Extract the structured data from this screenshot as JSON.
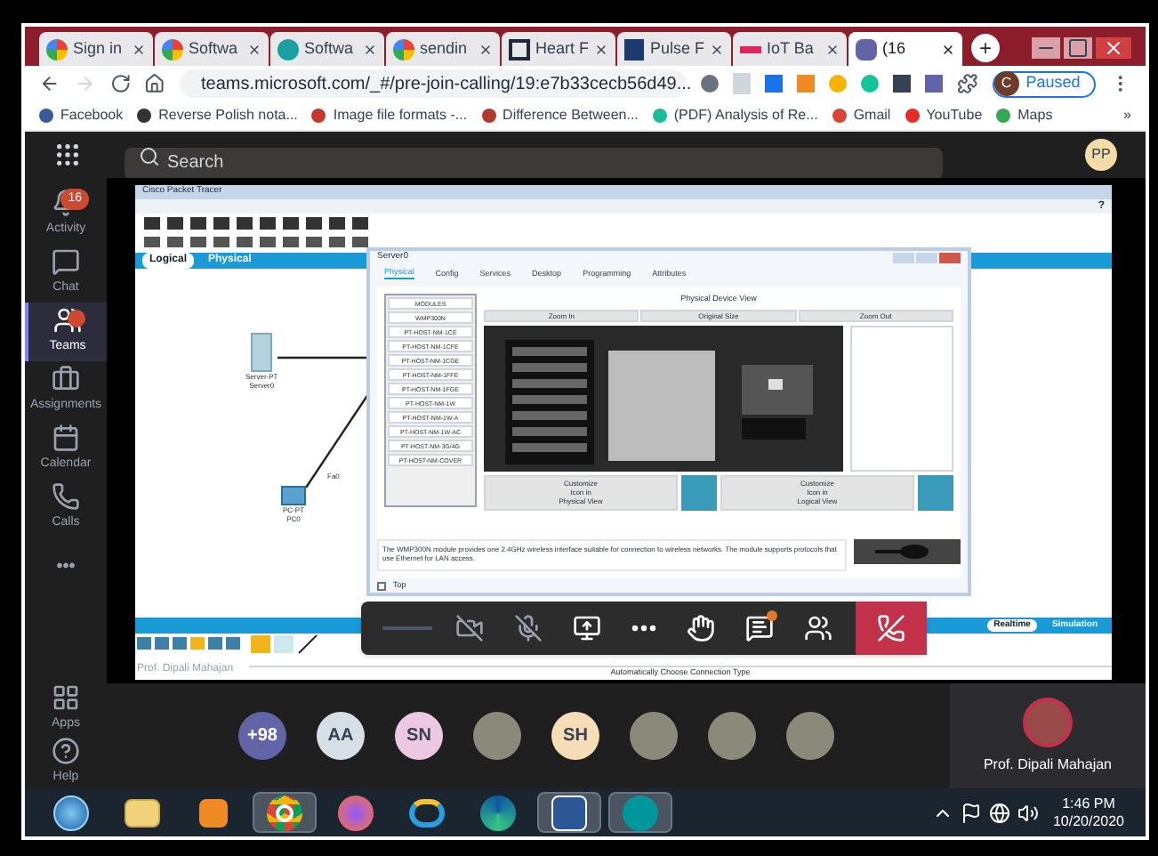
{
  "browser": {
    "tabs": [
      {
        "label": "Sign in",
        "selected": false
      },
      {
        "label": "Softwa",
        "selected": false
      },
      {
        "label": "Softwa",
        "selected": false
      },
      {
        "label": "sendin",
        "selected": false
      },
      {
        "label": "Heart F",
        "selected": false
      },
      {
        "label": "Pulse F",
        "selected": false
      },
      {
        "label": "IoT Ba",
        "selected": false
      },
      {
        "label": "(16",
        "selected": true
      }
    ],
    "new_tab": "+",
    "address": "teams.microsoft.com/_#/pre-join-calling/19:e7b33cecb56d49...",
    "profile": {
      "initial": "C",
      "label": "Paused"
    },
    "bookmarks": [
      {
        "label": "Facebook",
        "color": "#3b5998"
      },
      {
        "label": "Reverse Polish nota...",
        "color": "#333333"
      },
      {
        "label": "Image file formats -...",
        "color": "#c0392b"
      },
      {
        "label": "Difference Between...",
        "color": "#b03a2e"
      },
      {
        "label": "(PDF) Analysis of Re...",
        "color": "#1abc9c"
      },
      {
        "label": "Gmail",
        "color": "#d44638"
      },
      {
        "label": "YouTube",
        "color": "#e52d27"
      },
      {
        "label": "Maps",
        "color": "#34a853"
      }
    ],
    "more_bookmarks": "»"
  },
  "teams": {
    "search": {
      "placeholder": "Search"
    },
    "avatar": "PP",
    "rail": [
      {
        "label": "Activity",
        "badge": "16",
        "alert": false,
        "selected": false
      },
      {
        "label": "Chat",
        "alert": false,
        "selected": false
      },
      {
        "label": "Teams",
        "alert": true,
        "selected": true
      },
      {
        "label": "Assignments",
        "alert": false,
        "selected": false
      },
      {
        "label": "Calendar",
        "alert": false,
        "selected": false
      },
      {
        "label": "Calls",
        "alert": false,
        "selected": false
      },
      {
        "label": "•••",
        "alert": false,
        "selected": false
      }
    ],
    "rail_bottom": [
      {
        "label": "Apps"
      },
      {
        "label": "Help"
      }
    ]
  },
  "shared_screen": {
    "title": "Cisco Packet Tracer",
    "help": "?",
    "view_tabs": [
      {
        "label": "Logical",
        "selected": true
      },
      {
        "label": "Physical",
        "selected": false
      }
    ],
    "devices": [
      {
        "kind": "server",
        "label": "Server-PT\nServer0"
      },
      {
        "kind": "pc",
        "label": "PC-PT\nPC0"
      }
    ],
    "port_label": "Fa0",
    "dialog": {
      "title": "Server0",
      "tabs": [
        {
          "label": "Physical",
          "selected": true
        },
        {
          "label": "Config",
          "selected": false
        },
        {
          "label": "Services",
          "selected": false
        },
        {
          "label": "Desktop",
          "selected": false
        },
        {
          "label": "Programming",
          "selected": false
        },
        {
          "label": "Attributes",
          "selected": false
        }
      ],
      "modules": [
        "MODULES",
        "WMP300N",
        "PT-HOST-NM-1CE",
        "PT-HOST-NM-1CFE",
        "PT-HOST-NM-1CGE",
        "PT-HOST-NM-1FFE",
        "PT-HOST-NM-1FGE",
        "PT-HOST-NM-1W",
        "PT-HOST-NM-1W-A",
        "PT-HOST-NM-1W-AC",
        "PT-HOST-NM-3G/4G",
        "PT-HOST-NM-COVER"
      ],
      "view_title": "Physical Device View",
      "zoom_buttons": [
        "Zoom In",
        "Original Size",
        "Zoom Out"
      ],
      "customize_buttons": [
        "Customize\nIcon in\nPhysical View",
        "Customize\nIcon in\nLogical View"
      ],
      "description": "The WMP300N module provides one 2.4GHz wireless interface suitable for connection to wireless networks. The module supports protocols that use Ethernet for LAN access.",
      "top": {
        "label": "Top",
        "checked": false
      }
    },
    "modes": [
      {
        "label": "Realtime",
        "selected": true
      },
      {
        "label": "Simulation",
        "selected": false
      }
    ],
    "presenter_overlay": "Prof. Dipali Mahajan",
    "status": "Automatically Choose Connection Type"
  },
  "call_controls": [
    {
      "kind": "timer"
    },
    {
      "kind": "camera",
      "off": true
    },
    {
      "kind": "mic",
      "off": true
    },
    {
      "kind": "share"
    },
    {
      "kind": "more"
    },
    {
      "kind": "hand"
    },
    {
      "kind": "chat",
      "alert": true
    },
    {
      "kind": "people"
    },
    {
      "kind": "hangup"
    }
  ],
  "participants": [
    {
      "kind": "initials",
      "text": "+98",
      "color": "#6264a7"
    },
    {
      "kind": "initials",
      "text": "AA",
      "color": "#d6dee6"
    },
    {
      "kind": "initials",
      "text": "SN",
      "color": "#ecc8e2"
    },
    {
      "kind": "photo"
    },
    {
      "kind": "initials",
      "text": "SH",
      "color": "#f7dcb8"
    },
    {
      "kind": "photo"
    },
    {
      "kind": "photo"
    },
    {
      "kind": "photo"
    }
  ],
  "presenter": {
    "name": "Prof. Dipali Mahajan"
  },
  "taskbar": {
    "apps": [
      {
        "kind": "start",
        "active": false
      },
      {
        "kind": "folder",
        "active": false
      },
      {
        "kind": "media",
        "active": false
      },
      {
        "kind": "chrome",
        "active": true
      },
      {
        "kind": "firefox",
        "active": false
      },
      {
        "kind": "ie",
        "active": false
      },
      {
        "kind": "edge",
        "active": false
      },
      {
        "kind": "word",
        "active": true
      },
      {
        "kind": "arduino",
        "active": true
      }
    ],
    "time": "1:46 PM",
    "date": "10/20/2020"
  }
}
